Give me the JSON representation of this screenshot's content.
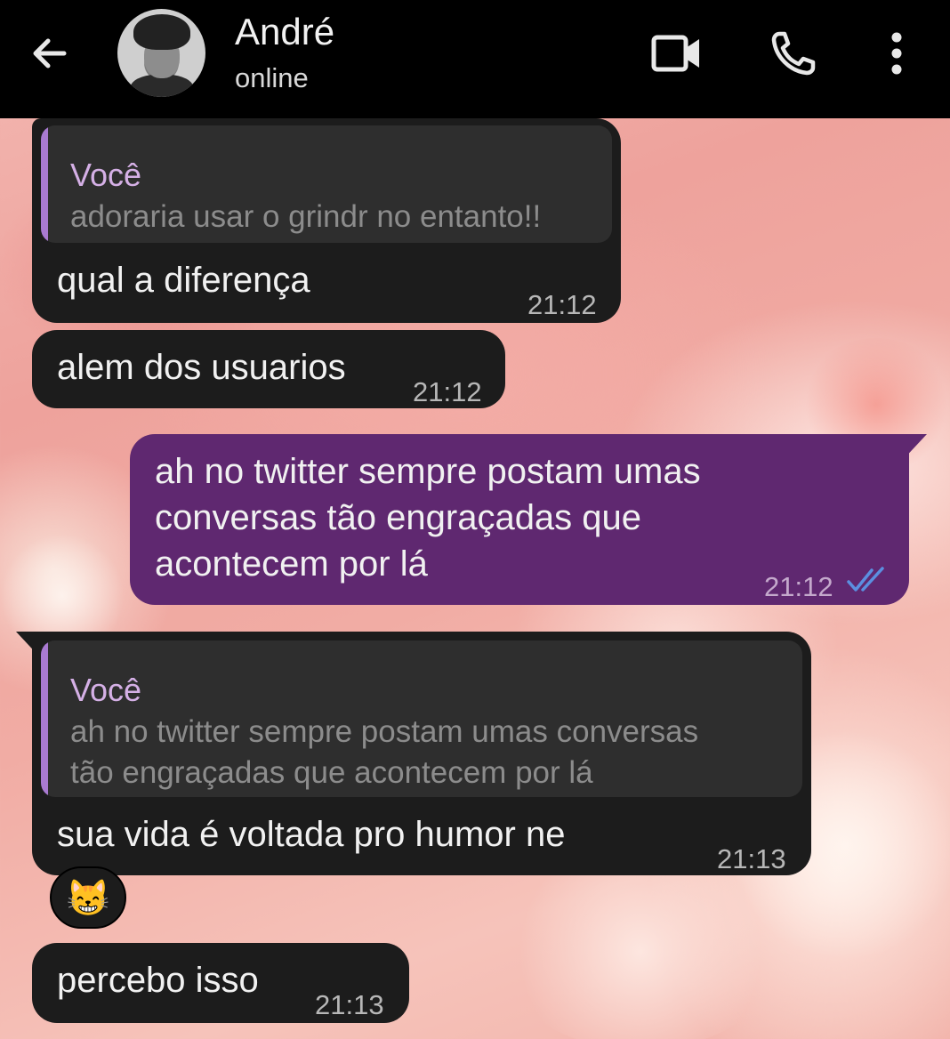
{
  "header": {
    "contact_name": "André",
    "status": "online",
    "icons": [
      "back-arrow-icon",
      "video-call-icon",
      "phone-call-icon",
      "more-options-icon"
    ]
  },
  "messages": [
    {
      "direction": "incoming",
      "reply": {
        "author": "Você",
        "text": "adoraria usar o grindr no entanto!!"
      },
      "text": "qual a diferença",
      "time": "21:12"
    },
    {
      "direction": "incoming",
      "text": "alem dos usuarios",
      "time": "21:12"
    },
    {
      "direction": "outgoing",
      "text_lines": [
        "ah no twitter sempre postam umas",
        "conversas tão engraçadas que",
        "acontecem por lá"
      ],
      "time": "21:12",
      "status": "read"
    },
    {
      "direction": "incoming",
      "reply": {
        "author": "Você",
        "text_lines": [
          "ah no twitter sempre postam umas conversas",
          "tão engraçadas que acontecem por lá"
        ]
      },
      "text": "sua vida é voltada pro humor ne",
      "time": "21:13",
      "reaction": "😸"
    },
    {
      "direction": "incoming",
      "text": "percebo isso",
      "time": "21:13"
    }
  ],
  "colors": {
    "header_bg": "#000000",
    "incoming_bubble": "#1c1c1c",
    "outgoing_bubble": "#5f2870",
    "quote_accent": "#a97ad1",
    "read_check": "#5b8fe0"
  }
}
